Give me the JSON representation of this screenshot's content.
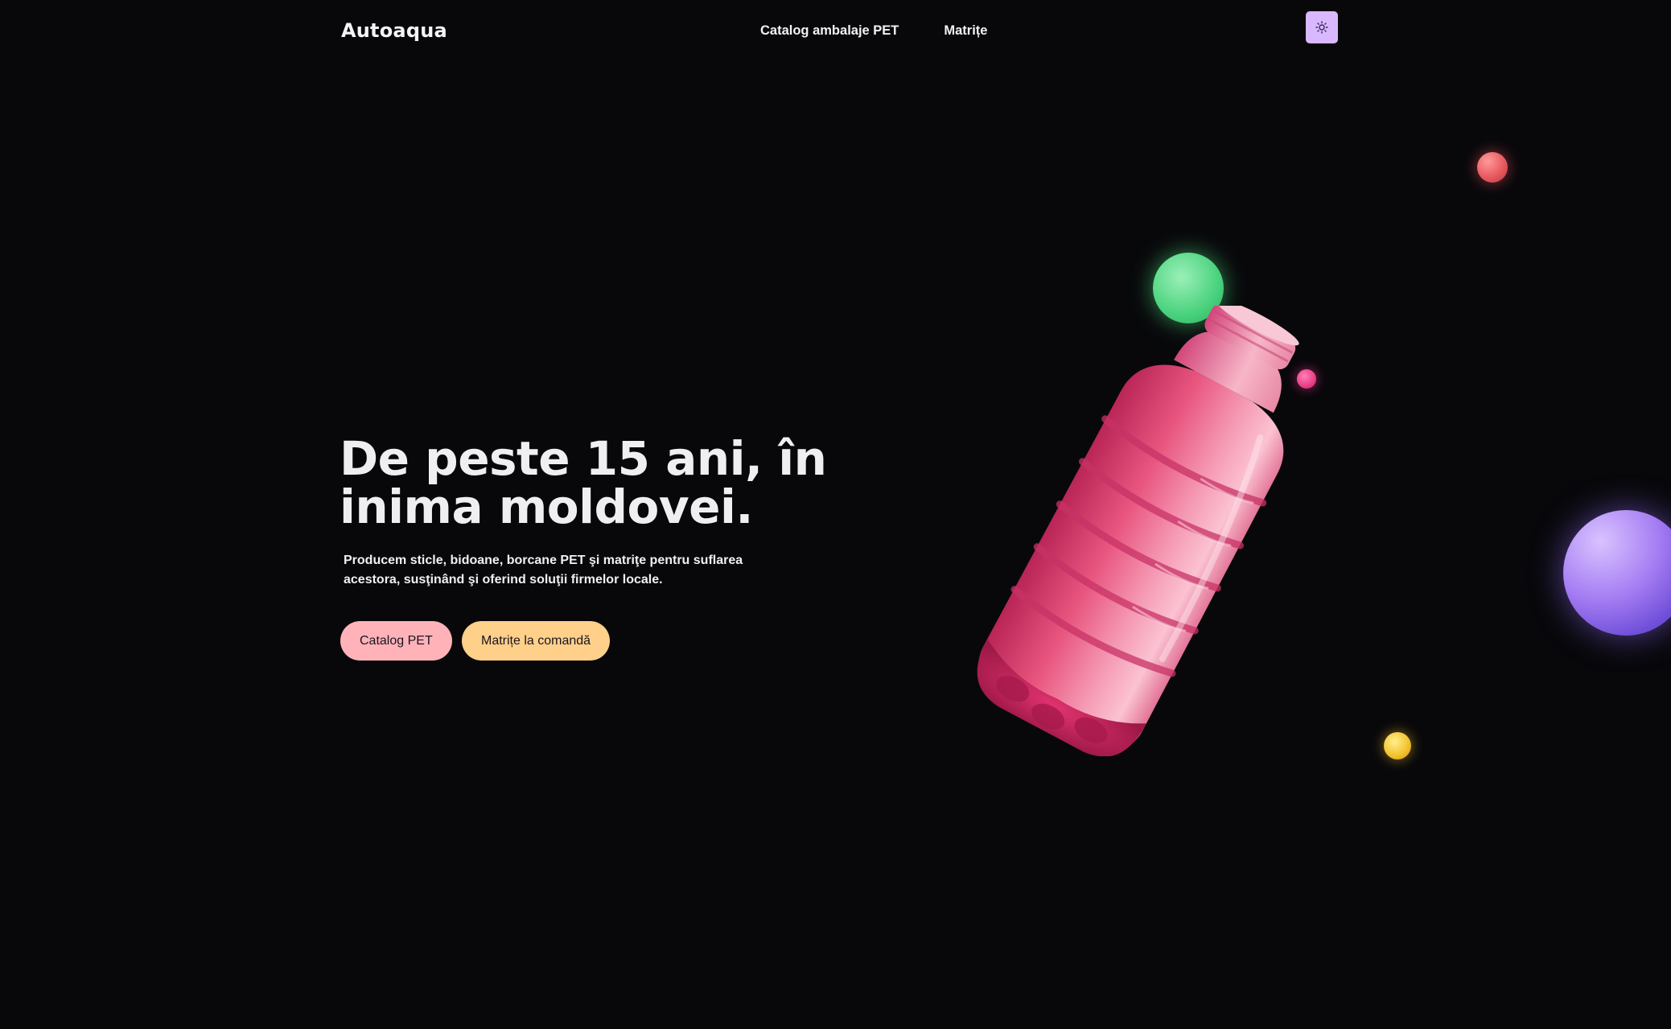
{
  "header": {
    "brand": "Autoaqua",
    "nav": [
      {
        "label": "Catalog ambalaje PET"
      },
      {
        "label": "Matrițe"
      }
    ],
    "theme_toggle_icon": "sun-icon"
  },
  "hero": {
    "title_lines": [
      "De peste 15 ani, în",
      "inima moldovei."
    ],
    "description_lines": [
      "Producem sticle, bidoane, borcane PET şi matriţe pentru suflarea",
      "acestora, susţinând şi oferind soluţii firmelor locale."
    ],
    "buttons": [
      {
        "label": "Catalog PET",
        "color": "#ffb3b8"
      },
      {
        "label": "Matrițe la comandă",
        "color": "#ffd08a"
      }
    ]
  },
  "colors": {
    "background": "#08080b",
    "toggle": "#d9b8ff",
    "bottle": "#e8557f"
  }
}
